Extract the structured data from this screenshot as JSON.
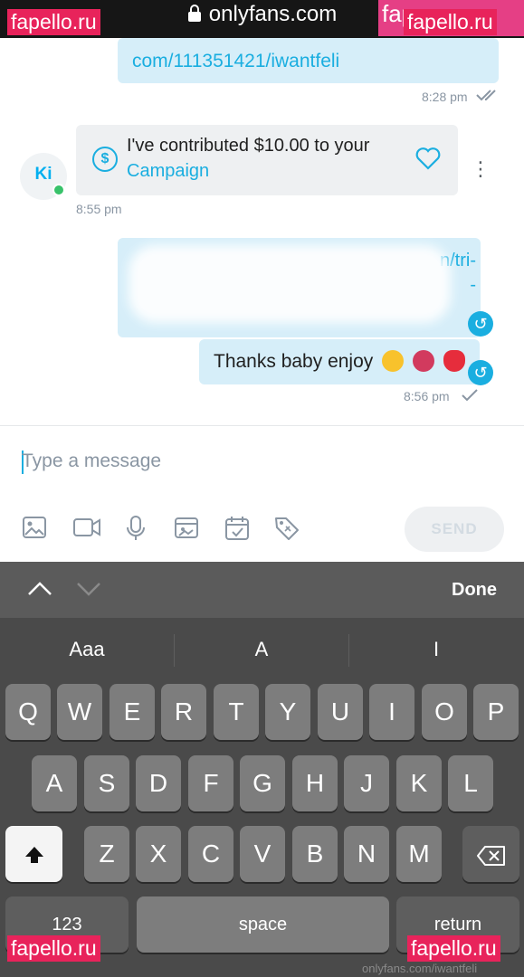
{
  "browser": {
    "url": "onlyfans.com"
  },
  "watermarks": {
    "top_left": "fapello.ru",
    "top_right": "fapello.ru",
    "top_right_bg": "fape",
    "bottom_left": "fapello.ru",
    "bottom_right": "fapello.ru"
  },
  "chat": {
    "link_top": "com/111351421/iwantfeli",
    "time_top": "8:28 pm",
    "avatar_initials": "Ki",
    "tip_line1": "I've contributed $10.00 to your",
    "tip_line2": "Campaign",
    "time_tip": "8:55 pm",
    "link2_line1": "n/tri-",
    "link2_line2": "-",
    "link2_line3": "",
    "message": "Thanks baby enjoy",
    "time_msg": "8:56 pm"
  },
  "composer": {
    "placeholder": "Type a message",
    "send_label": "SEND"
  },
  "keyboard": {
    "done_label": "Done",
    "suggestions": [
      "Aaa",
      "A",
      "I"
    ],
    "row1": [
      "Q",
      "W",
      "E",
      "R",
      "T",
      "Y",
      "U",
      "I",
      "O",
      "P"
    ],
    "row2": [
      "A",
      "S",
      "D",
      "F",
      "G",
      "H",
      "J",
      "K",
      "L"
    ],
    "row3": [
      "Z",
      "X",
      "C",
      "V",
      "B",
      "N",
      "M"
    ],
    "numbers_label": "123",
    "space_label": "space",
    "return_label": "return",
    "footer_text": "onlyfans.com/iwantfeli"
  },
  "colors": {
    "accent": "#1aaee0",
    "bubble_out": "#d6eef9",
    "bubble_in": "#eef0f2",
    "watermark": "#e8235b"
  }
}
